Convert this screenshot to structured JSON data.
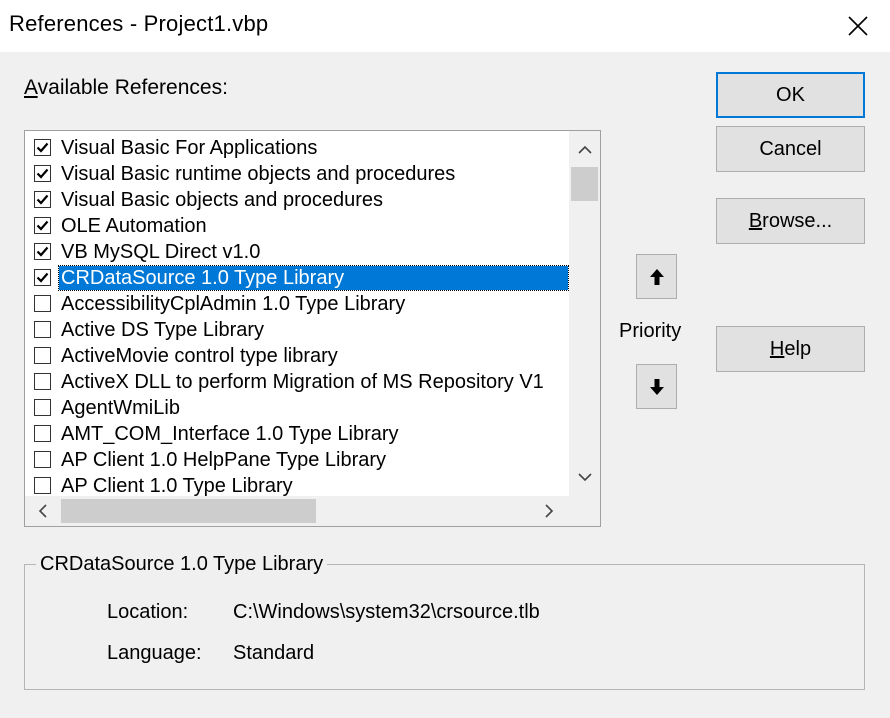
{
  "window": {
    "title": "References - Project1.vbp",
    "close_glyph": "close-icon"
  },
  "available_label_first": "A",
  "available_label_rest": "vailable References:",
  "references": [
    {
      "label": "Visual Basic For Applications",
      "checked": true,
      "selected": false
    },
    {
      "label": "Visual Basic runtime objects and procedures",
      "checked": true,
      "selected": false
    },
    {
      "label": "Visual Basic objects and procedures",
      "checked": true,
      "selected": false
    },
    {
      "label": "OLE Automation",
      "checked": true,
      "selected": false
    },
    {
      "label": "VB MySQL Direct v1.0",
      "checked": true,
      "selected": false
    },
    {
      "label": "CRDataSource 1.0 Type Library",
      "checked": true,
      "selected": true
    },
    {
      "label": "AccessibilityCplAdmin 1.0 Type Library",
      "checked": false,
      "selected": false
    },
    {
      "label": "Active DS Type Library",
      "checked": false,
      "selected": false
    },
    {
      "label": "ActiveMovie control type library",
      "checked": false,
      "selected": false
    },
    {
      "label": "ActiveX DLL to perform Migration of MS Repository V1",
      "checked": false,
      "selected": false
    },
    {
      "label": "AgentWmiLib",
      "checked": false,
      "selected": false
    },
    {
      "label": "AMT_COM_Interface 1.0 Type Library",
      "checked": false,
      "selected": false
    },
    {
      "label": "AP Client 1.0 HelpPane Type Library",
      "checked": false,
      "selected": false
    },
    {
      "label": "AP Client 1.0 Type Library",
      "checked": false,
      "selected": false
    }
  ],
  "buttons": {
    "ok": "OK",
    "cancel": "Cancel",
    "browse_first": "B",
    "browse_rest": "rowse...",
    "help_first": "H",
    "help_rest": "elp"
  },
  "priority_label": "Priority",
  "details": {
    "caption": "CRDataSource 1.0 Type Library",
    "location_label": "Location:",
    "location_value": "C:\\Windows\\system32\\crsource.tlb",
    "language_label": "Language:",
    "language_value": "Standard"
  }
}
